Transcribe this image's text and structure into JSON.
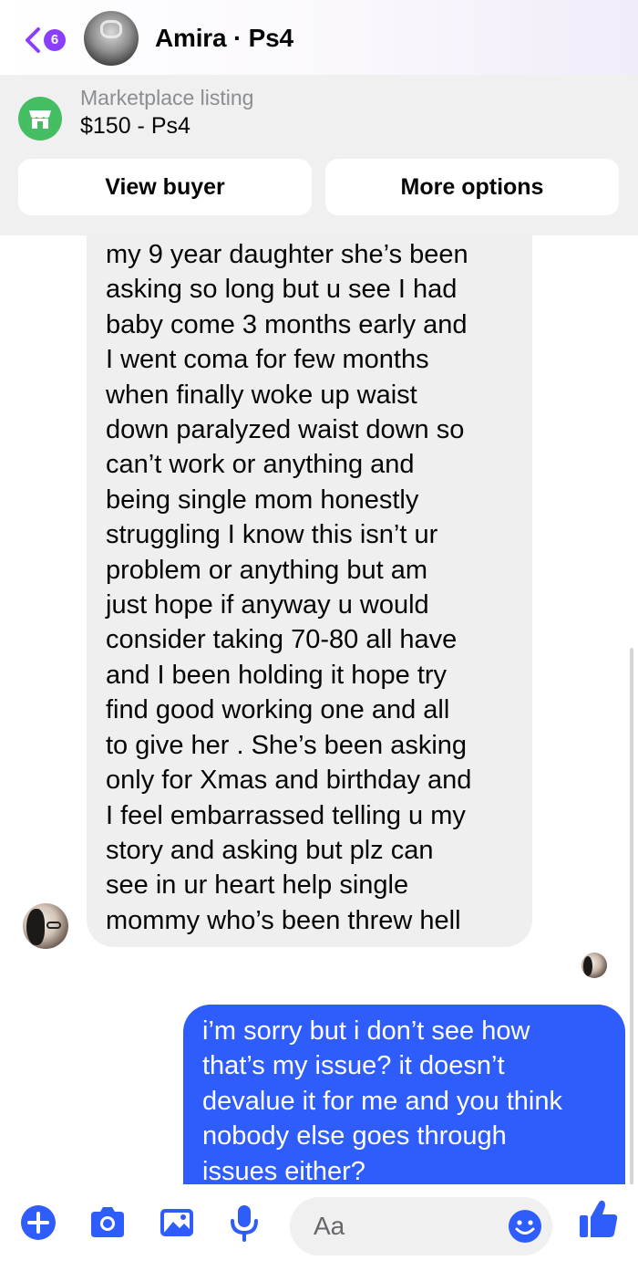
{
  "header": {
    "back_count": "6",
    "title": "Amira · Ps4"
  },
  "listing": {
    "label": "Marketplace listing",
    "price_title": "$150 - Ps4",
    "view_buyer": "View buyer",
    "more_options": "More options"
  },
  "messages": {
    "incoming": {
      "lines": [
        "my 9 year daughter she’s been",
        "asking so long but u see I had",
        "baby come 3 months early and",
        "I went coma for few months",
        "when finally woke up waist",
        "down paralyzed waist down so",
        "can’t work or anything and",
        "being single mom honestly",
        "struggling I know this isn’t ur",
        "problem or anything but am",
        "just hope if anyway u would",
        "consider taking 70-80 all have",
        "and I been holding it hope try",
        "find good working one and all",
        "to give her . She’s been asking",
        "only for Xmas and birthday and",
        "I feel embarrassed telling u my",
        "story and asking but plz can",
        "see in ur heart help single",
        "mommy who’s been threw hell"
      ]
    },
    "outgoing": {
      "lines": [
        "i’m sorry but i don’t see how",
        "that’s my issue? it doesn’t",
        "devalue it for me and you think",
        "nobody else goes through",
        "issues either?"
      ]
    }
  },
  "composer": {
    "placeholder": "Aa"
  },
  "colors": {
    "accent": "#8a3ffc",
    "outgoing_bubble": "#2f5dfc",
    "incoming_bubble": "#efefef",
    "icon_blue": "#2f5dfc",
    "marketplace_green": "#45bd62"
  },
  "icons": {
    "back": "chevron-left-icon",
    "marketplace": "storefront-icon",
    "add": "plus-circle-icon",
    "camera": "camera-icon",
    "gallery": "image-icon",
    "mic": "microphone-icon",
    "emoji": "smiley-icon",
    "like": "thumbs-up-icon"
  }
}
